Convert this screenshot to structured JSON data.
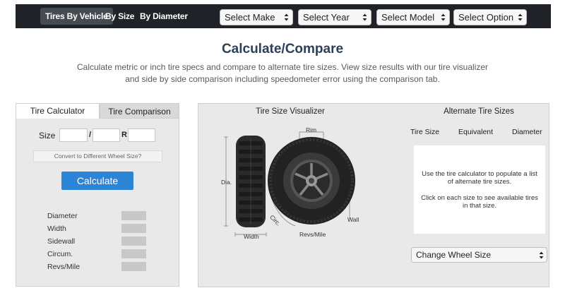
{
  "nav": {
    "tabs": [
      "Tires By Vehicle",
      "By Size",
      "By Diameter"
    ],
    "selects": [
      "Select Make",
      "Select Year",
      "Select Model",
      "Select Option"
    ]
  },
  "header": {
    "title": "Calculate/Compare",
    "line1": "Calculate metric or inch tire specs and compare to alternate tire sizes. View size results with our tire visualizer",
    "line2": "and side by side comparison including speedometer error using the comparison tab."
  },
  "calc": {
    "tab_calculator": "Tire Calculator",
    "tab_comparison": "Tire Comparison",
    "size_label": "Size",
    "sep_slash": "/",
    "sep_r": "R",
    "convert_label": "Convert to Different Wheel Size?",
    "calculate_label": "Calculate",
    "results": [
      "Diameter",
      "Width",
      "Sidewall",
      "Circum.",
      "Revs/Mile"
    ]
  },
  "visualizer": {
    "title": "Tire Size Visualizer",
    "labels": {
      "rim": "Rim",
      "dia": "Dia.",
      "width": "Width",
      "circ": "Circ.",
      "revs": "Revs/Mile",
      "wall": "Wall"
    }
  },
  "alternate": {
    "title": "Alternate Tire Sizes",
    "col_size": "Tire Size",
    "col_equiv": "Equivalent",
    "col_diam": "Diameter",
    "msg1": "Use the tire calculator to populate a list of alternate tire sizes.",
    "msg2": "Click on each size to see available tires in that size.",
    "wheel_select": "Change Wheel Size"
  }
}
